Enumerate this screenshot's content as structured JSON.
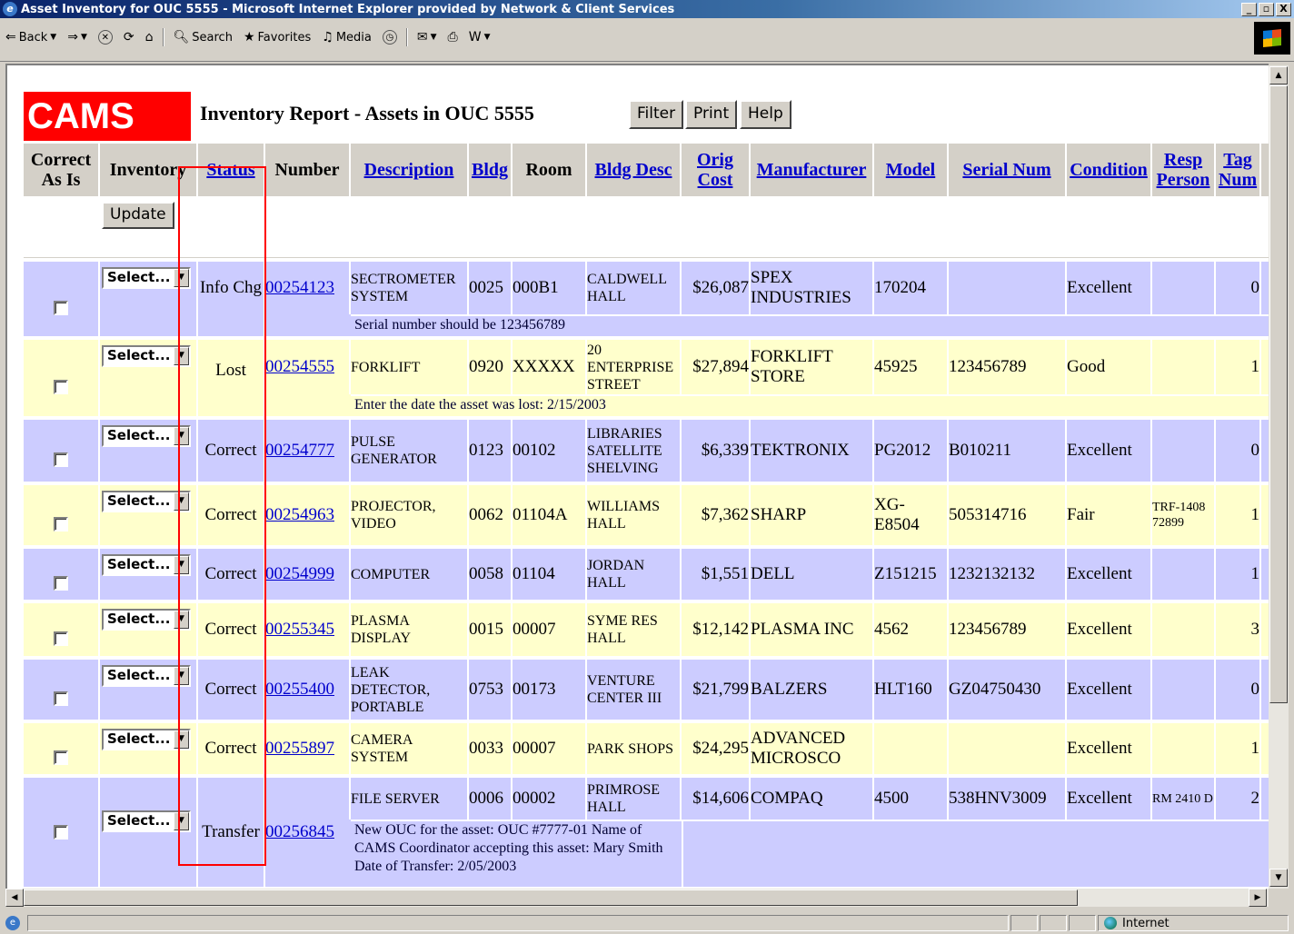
{
  "window": {
    "title": "Asset Inventory for OUC 5555 - Microsoft Internet Explorer provided by Network & Client Services",
    "minimize": "_",
    "maximize": "▫",
    "close": "X"
  },
  "toolbar": {
    "back": "Back",
    "search": "Search",
    "favorites": "Favorites",
    "media": "Media"
  },
  "status_bar": {
    "zone": "Internet"
  },
  "page": {
    "logo": "CAMS",
    "title": "Inventory Report - Assets in OUC 5555",
    "buttons": {
      "filter": "Filter",
      "print": "Print",
      "help": "Help",
      "update": "Update"
    }
  },
  "headers": {
    "correct_as_is": "Correct As Is",
    "inventory": "Inventory",
    "status": "Status",
    "number": "Number",
    "description": "Description",
    "bldg": "Bldg",
    "room": "Room",
    "bldg_desc": "Bldg Desc",
    "orig_cost": "Orig Cost",
    "manufacturer": "Manufacturer",
    "model": "Model",
    "serial_num": "Serial Num",
    "condition": "Condition",
    "resp_person": "Resp Person",
    "tag_num": "Tag Num"
  },
  "select_label": "Select...",
  "rows": [
    {
      "status": "Info Chg",
      "number": "00254123",
      "description": "SECTROMETER SYSTEM",
      "bldg": "0025",
      "room": "000B1",
      "bldg_desc": "CALDWELL HALL",
      "cost": "$26,087",
      "manufacturer": "SPEX INDUSTRIES",
      "model": "170204",
      "serial": "",
      "condition": "Excellent",
      "resp": "",
      "tag": "0",
      "note": "Serial number should be 123456789"
    },
    {
      "status": "Lost",
      "number": "00254555",
      "description": "FORKLIFT",
      "bldg": "0920",
      "room": "XXXXX",
      "bldg_desc": "20 ENTERPRISE STREET",
      "cost": "$27,894",
      "manufacturer": "FORKLIFT STORE",
      "model": "45925",
      "serial": "123456789",
      "condition": "Good",
      "resp": "",
      "tag": "1",
      "note": "Enter the date the asset was lost: 2/15/2003"
    },
    {
      "status": "Correct",
      "number": "00254777",
      "description": "PULSE GENERATOR",
      "bldg": "0123",
      "room": "00102",
      "bldg_desc": "LIBRARIES SATELLITE SHELVING",
      "cost": "$6,339",
      "manufacturer": "TEKTRONIX",
      "model": "PG2012",
      "serial": "B010211",
      "condition": "Excellent",
      "resp": "",
      "tag": "0",
      "note": ""
    },
    {
      "status": "Correct",
      "number": "00254963",
      "description": "PROJECTOR, VIDEO",
      "bldg": "0062",
      "room": "01104A",
      "bldg_desc": "WILLIAMS HALL",
      "cost": "$7,362",
      "manufacturer": "SHARP",
      "model": "XG-E8504",
      "serial": "505314716",
      "condition": "Fair",
      "resp": "TRF-1408 72899",
      "tag": "1",
      "note": ""
    },
    {
      "status": "Correct",
      "number": "00254999",
      "description": "COMPUTER",
      "bldg": "0058",
      "room": "01104",
      "bldg_desc": "JORDAN HALL",
      "cost": "$1,551",
      "manufacturer": "DELL",
      "model": "Z151215",
      "serial": "1232132132",
      "condition": "Excellent",
      "resp": "",
      "tag": "1",
      "note": ""
    },
    {
      "status": "Correct",
      "number": "00255345",
      "description": "PLASMA DISPLAY",
      "bldg": "0015",
      "room": "00007",
      "bldg_desc": "SYME RES HALL",
      "cost": "$12,142",
      "manufacturer": "PLASMA INC",
      "model": "4562",
      "serial": "123456789",
      "condition": "Excellent",
      "resp": "",
      "tag": "3",
      "note": ""
    },
    {
      "status": "Correct",
      "number": "00255400",
      "description": "LEAK DETECTOR, PORTABLE",
      "bldg": "0753",
      "room": "00173",
      "bldg_desc": "VENTURE CENTER III",
      "cost": "$21,799",
      "manufacturer": "BALZERS",
      "model": "HLT160",
      "serial": "GZ04750430",
      "condition": "Excellent",
      "resp": "",
      "tag": "0",
      "note": ""
    },
    {
      "status": "Correct",
      "number": "00255897",
      "description": "CAMERA SYSTEM",
      "bldg": "0033",
      "room": "00007",
      "bldg_desc": "PARK SHOPS",
      "cost": "$24,295",
      "manufacturer": "ADVANCED MICROSCO",
      "model": "",
      "serial": "",
      "condition": "Excellent",
      "resp": "",
      "tag": "1",
      "note": ""
    },
    {
      "status": "Transfer",
      "number": "00256845",
      "description": "FILE SERVER",
      "bldg": "0006",
      "room": "00002",
      "bldg_desc": "PRIMROSE HALL",
      "cost": "$14,606",
      "manufacturer": "COMPAQ",
      "model": "4500",
      "serial": "538HNV3009",
      "condition": "Excellent",
      "resp": "RM 2410 D",
      "tag": "2",
      "note": "New OUC for the asset: OUC #7777-01 Name of CAMS Coordinator accepting this asset: Mary Smith Date of Transfer: 2/05/2003"
    }
  ],
  "colors": {
    "purple_row": "#ccccff",
    "yellow_row": "#ffffcc",
    "logo_bg": "#ff0000",
    "highlight_box": "#ff0000",
    "link": "#0000cc"
  }
}
